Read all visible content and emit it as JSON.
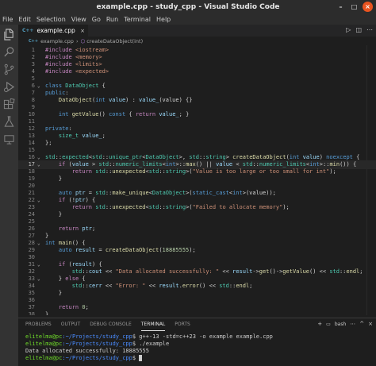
{
  "window": {
    "title": "example.cpp - study_cpp - Visual Studio Code",
    "controls": [
      "–",
      "□",
      "×"
    ]
  },
  "menu": [
    "File",
    "Edit",
    "Selection",
    "View",
    "Go",
    "Run",
    "Terminal",
    "Help"
  ],
  "activity_icons": [
    "explorer-icon",
    "search-icon",
    "source-control-icon",
    "run-debug-icon",
    "extensions-icon",
    "testing-icon",
    "remote-explorer-icon"
  ],
  "editor_tab": {
    "file_type": "C++",
    "filename": "example.cpp",
    "close": "×"
  },
  "breadcrumb": {
    "file": "example.cpp",
    "symbol": "createDataObject(int)"
  },
  "editor": {
    "active_line": 17,
    "lines": [
      {
        "n": "1",
        "parts": [
          [
            "c",
            "#include "
          ],
          [
            "s",
            "<iostream>"
          ]
        ]
      },
      {
        "n": "2",
        "parts": [
          [
            "c",
            "#include "
          ],
          [
            "s",
            "<memory>"
          ]
        ]
      },
      {
        "n": "3",
        "parts": [
          [
            "c",
            "#include "
          ],
          [
            "s",
            "<limits>"
          ]
        ]
      },
      {
        "n": "4",
        "parts": [
          [
            "c",
            "#include "
          ],
          [
            "s",
            "<expected>"
          ]
        ]
      },
      {
        "n": "5",
        "parts": []
      },
      {
        "n": "6",
        "parts": [
          [
            "k",
            "class "
          ],
          [
            "t",
            "DataObject"
          ],
          [
            "p",
            " {"
          ]
        ]
      },
      {
        "n": "7",
        "parts": [
          [
            "k",
            "public"
          ],
          [
            "p",
            ":"
          ]
        ]
      },
      {
        "n": "8",
        "parts": [
          [
            "p",
            "    "
          ],
          [
            "f",
            "DataObject"
          ],
          [
            "p",
            "("
          ],
          [
            "k",
            "int "
          ],
          [
            "v",
            "value"
          ],
          [
            "p",
            ") : "
          ],
          [
            "v",
            "value_"
          ],
          [
            "p",
            "(value) {}"
          ]
        ]
      },
      {
        "n": "9",
        "parts": []
      },
      {
        "n": "10",
        "parts": [
          [
            "p",
            "    "
          ],
          [
            "k",
            "int "
          ],
          [
            "f",
            "getValue"
          ],
          [
            "p",
            "() "
          ],
          [
            "k",
            "const"
          ],
          [
            "p",
            " { "
          ],
          [
            "c",
            "return "
          ],
          [
            "v",
            "value_"
          ],
          [
            "p",
            "; }"
          ]
        ]
      },
      {
        "n": "11",
        "parts": []
      },
      {
        "n": "12",
        "parts": [
          [
            "k",
            "private"
          ],
          [
            "p",
            ":"
          ]
        ]
      },
      {
        "n": "13",
        "parts": [
          [
            "p",
            "    "
          ],
          [
            "t",
            "size_t "
          ],
          [
            "v",
            "value_"
          ],
          [
            "p",
            ";"
          ]
        ]
      },
      {
        "n": "14",
        "parts": [
          [
            "p",
            "};"
          ]
        ]
      },
      {
        "n": "15",
        "parts": []
      },
      {
        "n": "16",
        "parts": [
          [
            "t",
            "std"
          ],
          [
            "p",
            "::"
          ],
          [
            "t",
            "expected"
          ],
          [
            "p",
            "<"
          ],
          [
            "t",
            "std"
          ],
          [
            "p",
            "::"
          ],
          [
            "t",
            "unique_ptr"
          ],
          [
            "p",
            "<"
          ],
          [
            "t",
            "DataObject"
          ],
          [
            "p",
            ">, "
          ],
          [
            "t",
            "std"
          ],
          [
            "p",
            "::"
          ],
          [
            "t",
            "string"
          ],
          [
            "p",
            "> "
          ],
          [
            "f",
            "createDataObject"
          ],
          [
            "p",
            "("
          ],
          [
            "k",
            "int "
          ],
          [
            "v",
            "value"
          ],
          [
            "p",
            ") "
          ],
          [
            "k",
            "noexcept"
          ],
          [
            "p",
            " {"
          ]
        ]
      },
      {
        "n": "17",
        "parts": [
          [
            "p",
            "    "
          ],
          [
            "c",
            "if"
          ],
          [
            "p",
            " ("
          ],
          [
            "v",
            "value"
          ],
          [
            "p",
            " > "
          ],
          [
            "t",
            "std"
          ],
          [
            "p",
            "::"
          ],
          [
            "t",
            "numeric_limits"
          ],
          [
            "p",
            "<"
          ],
          [
            "k",
            "int"
          ],
          [
            "p",
            ">::"
          ],
          [
            "f",
            "max"
          ],
          [
            "p",
            "() || "
          ],
          [
            "v",
            "value"
          ],
          [
            "p",
            " < "
          ],
          [
            "t",
            "std"
          ],
          [
            "p",
            "::"
          ],
          [
            "t",
            "numeric_limits"
          ],
          [
            "p",
            "<"
          ],
          [
            "k",
            "int"
          ],
          [
            "p",
            ">::"
          ],
          [
            "f",
            "min"
          ],
          [
            "p",
            "()) {"
          ]
        ]
      },
      {
        "n": "18",
        "parts": [
          [
            "p",
            "        "
          ],
          [
            "c",
            "return "
          ],
          [
            "t",
            "std"
          ],
          [
            "p",
            "::"
          ],
          [
            "f",
            "unexpected"
          ],
          [
            "p",
            "<"
          ],
          [
            "t",
            "std"
          ],
          [
            "p",
            "::"
          ],
          [
            "t",
            "string"
          ],
          [
            "p",
            ">("
          ],
          [
            "s",
            "\"Value is too large or too small for int\""
          ],
          [
            "p",
            ");"
          ]
        ]
      },
      {
        "n": "19",
        "parts": [
          [
            "p",
            "    }"
          ]
        ]
      },
      {
        "n": "20",
        "parts": []
      },
      {
        "n": "21",
        "parts": [
          [
            "p",
            "    "
          ],
          [
            "k",
            "auto "
          ],
          [
            "v",
            "ptr"
          ],
          [
            "p",
            " = "
          ],
          [
            "t",
            "std"
          ],
          [
            "p",
            "::"
          ],
          [
            "f",
            "make_unique"
          ],
          [
            "p",
            "<"
          ],
          [
            "t",
            "DataObject"
          ],
          [
            "p",
            ">("
          ],
          [
            "k",
            "static_cast"
          ],
          [
            "p",
            "<"
          ],
          [
            "k",
            "int"
          ],
          [
            "p",
            ">(value));"
          ]
        ]
      },
      {
        "n": "22",
        "parts": [
          [
            "p",
            "    "
          ],
          [
            "c",
            "if"
          ],
          [
            "p",
            " (!"
          ],
          [
            "v",
            "ptr"
          ],
          [
            "p",
            ") {"
          ]
        ]
      },
      {
        "n": "23",
        "parts": [
          [
            "p",
            "        "
          ],
          [
            "c",
            "return "
          ],
          [
            "t",
            "std"
          ],
          [
            "p",
            "::"
          ],
          [
            "f",
            "unexpected"
          ],
          [
            "p",
            "<"
          ],
          [
            "t",
            "std"
          ],
          [
            "p",
            "::"
          ],
          [
            "t",
            "string"
          ],
          [
            "p",
            ">("
          ],
          [
            "s",
            "\"Failed to allocate memory\""
          ],
          [
            "p",
            ");"
          ]
        ]
      },
      {
        "n": "24",
        "parts": [
          [
            "p",
            "    }"
          ]
        ]
      },
      {
        "n": "25",
        "parts": []
      },
      {
        "n": "26",
        "parts": [
          [
            "p",
            "    "
          ],
          [
            "c",
            "return "
          ],
          [
            "v",
            "ptr"
          ],
          [
            "p",
            ";"
          ]
        ]
      },
      {
        "n": "27",
        "parts": [
          [
            "p",
            "}"
          ]
        ]
      },
      {
        "n": "28",
        "parts": [
          [
            "k",
            "int "
          ],
          [
            "f",
            "main"
          ],
          [
            "p",
            "() {"
          ]
        ]
      },
      {
        "n": "29",
        "parts": [
          [
            "p",
            "    "
          ],
          [
            "k",
            "auto "
          ],
          [
            "v",
            "result"
          ],
          [
            "p",
            " = "
          ],
          [
            "f",
            "createDataObject"
          ],
          [
            "p",
            "("
          ],
          [
            "n",
            "18885555"
          ],
          [
            "p",
            ");"
          ]
        ]
      },
      {
        "n": "30",
        "parts": []
      },
      {
        "n": "31",
        "parts": [
          [
            "p",
            "    "
          ],
          [
            "c",
            "if"
          ],
          [
            "p",
            " ("
          ],
          [
            "v",
            "result"
          ],
          [
            "p",
            ") {"
          ]
        ]
      },
      {
        "n": "32",
        "parts": [
          [
            "p",
            "        "
          ],
          [
            "t",
            "std"
          ],
          [
            "p",
            "::"
          ],
          [
            "v",
            "cout"
          ],
          [
            "p",
            " << "
          ],
          [
            "s",
            "\"Data allocated successfully: \""
          ],
          [
            "p",
            " << "
          ],
          [
            "v",
            "result"
          ],
          [
            "p",
            "->"
          ],
          [
            "f",
            "get"
          ],
          [
            "p",
            "()->"
          ],
          [
            "f",
            "getValue"
          ],
          [
            "p",
            "() << "
          ],
          [
            "t",
            "std"
          ],
          [
            "p",
            "::"
          ],
          [
            "f",
            "endl"
          ],
          [
            "p",
            ";"
          ]
        ]
      },
      {
        "n": "33",
        "parts": [
          [
            "p",
            "    } "
          ],
          [
            "c",
            "else"
          ],
          [
            "p",
            " {"
          ]
        ]
      },
      {
        "n": "34",
        "parts": [
          [
            "p",
            "        "
          ],
          [
            "t",
            "std"
          ],
          [
            "p",
            "::"
          ],
          [
            "v",
            "cerr"
          ],
          [
            "p",
            " << "
          ],
          [
            "s",
            "\"Error: \""
          ],
          [
            "p",
            " << "
          ],
          [
            "v",
            "result"
          ],
          [
            "p",
            "."
          ],
          [
            "f",
            "error"
          ],
          [
            "p",
            "() << "
          ],
          [
            "t",
            "std"
          ],
          [
            "p",
            "::"
          ],
          [
            "f",
            "endl"
          ],
          [
            "p",
            ";"
          ]
        ]
      },
      {
        "n": "35",
        "parts": [
          [
            "p",
            "    }"
          ]
        ]
      },
      {
        "n": "36",
        "parts": []
      },
      {
        "n": "37",
        "parts": [
          [
            "p",
            "    "
          ],
          [
            "c",
            "return "
          ],
          [
            "n",
            "0"
          ],
          [
            "p",
            ";"
          ]
        ]
      },
      {
        "n": "38",
        "parts": [
          [
            "p",
            "}"
          ]
        ]
      }
    ]
  },
  "panel": {
    "tabs": [
      "PROBLEMS",
      "OUTPUT",
      "DEBUG CONSOLE",
      "TERMINAL",
      "PORTS"
    ],
    "active_tab": "TERMINAL",
    "shell": "bash",
    "actions": [
      "+",
      "⋯",
      "^",
      "×"
    ]
  },
  "terminal": {
    "lines": [
      {
        "user": "elitelma@pc",
        "path": ":~/Projects/study_cpp",
        "cmd": "$ g++-13 -std=c++23 -o example example.cpp"
      },
      {
        "user": "elitelma@pc",
        "path": ":~/Projects/study_cpp",
        "cmd": "$ ./example"
      },
      {
        "user": "",
        "path": "",
        "cmd": "Data allocated successfully: 18885555"
      },
      {
        "user": "elitelma@pc",
        "path": ":~/Projects/study_cpp",
        "cmd": "$ "
      }
    ]
  }
}
